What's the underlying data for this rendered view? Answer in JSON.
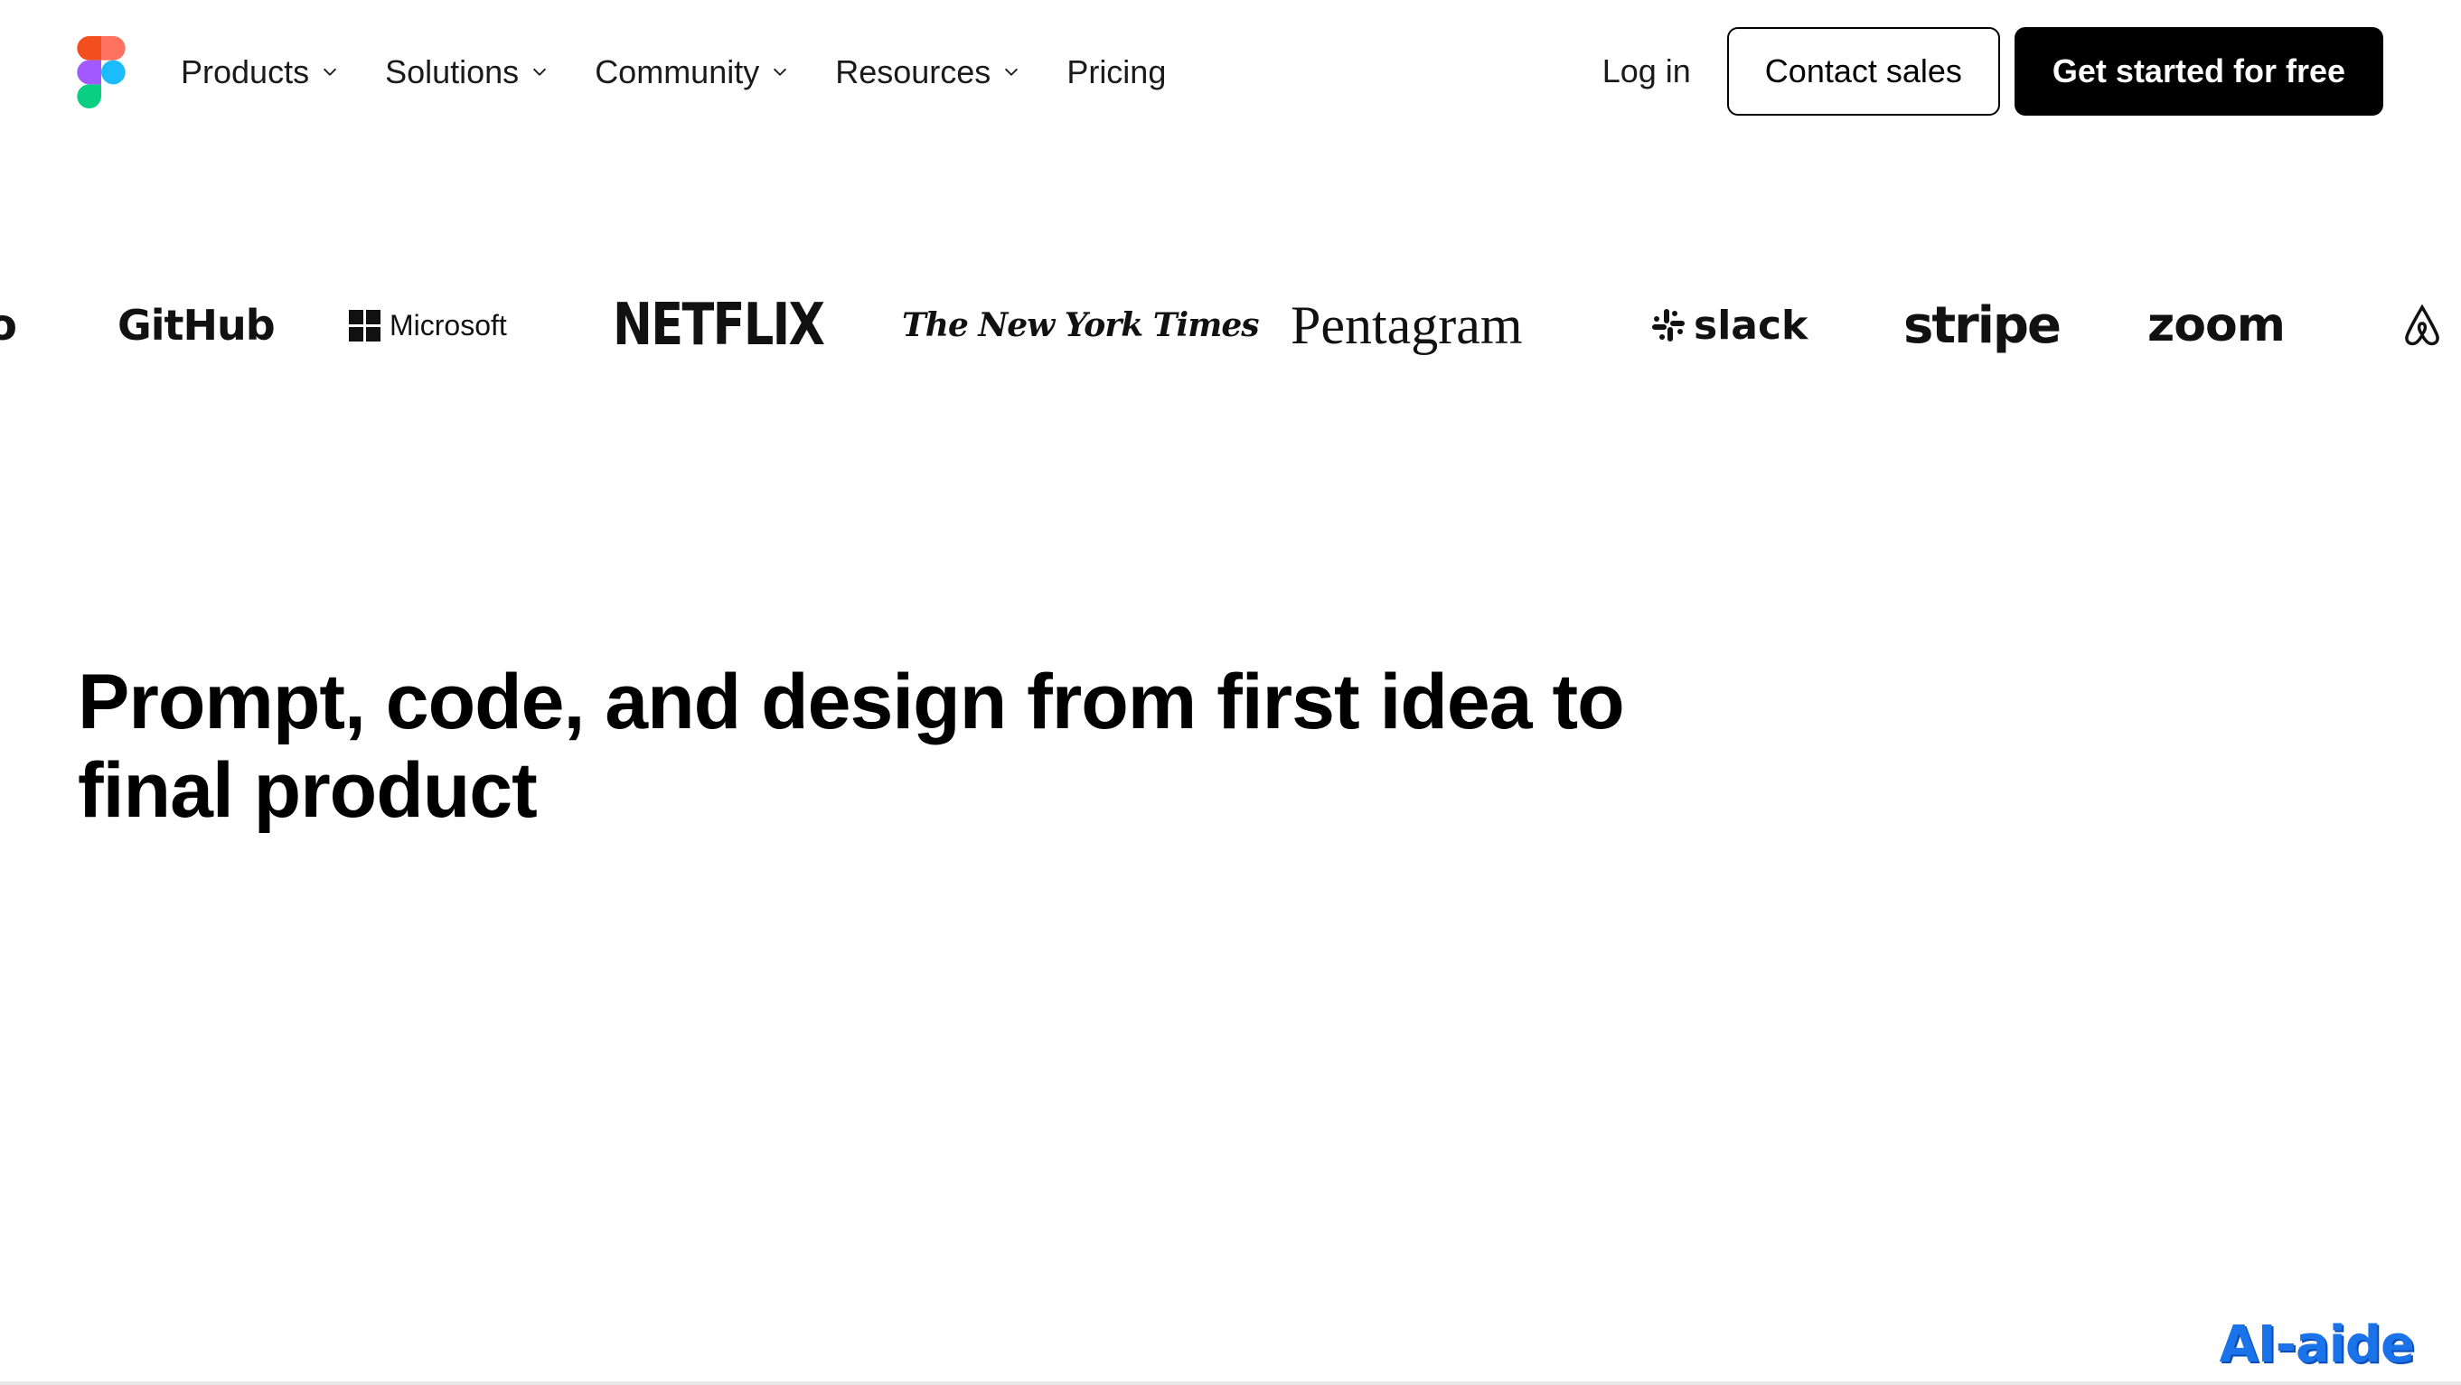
{
  "nav": {
    "logo_icon": "figma-logo-icon",
    "items": [
      {
        "label": "Products",
        "has_dropdown": true
      },
      {
        "label": "Solutions",
        "has_dropdown": true
      },
      {
        "label": "Community",
        "has_dropdown": true
      },
      {
        "label": "Resources",
        "has_dropdown": true
      },
      {
        "label": "Pricing",
        "has_dropdown": false
      }
    ],
    "login_label": "Log in",
    "contact_label": "Contact sales",
    "cta_label": "Get started for free"
  },
  "logos": {
    "partial_left": "o",
    "github": "GitHub",
    "microsoft": "Microsoft",
    "netflix": "NETFLIX",
    "nyt": "The New York Times",
    "pentagram": "Pentagram",
    "slack": "slack",
    "stripe": "stripe",
    "zoom": "zoom",
    "airbnb_icon": "airbnb-logo-icon"
  },
  "hero": {
    "title": "Prompt, code, and design from first idea to final product"
  },
  "watermark": "AI-aide",
  "colors": {
    "figma_red": "#F24E1E",
    "figma_orange": "#FF7262",
    "figma_purple": "#A259FF",
    "figma_blue": "#1ABCFE",
    "figma_green": "#0ACF83",
    "watermark_blue": "#1a73e8"
  }
}
